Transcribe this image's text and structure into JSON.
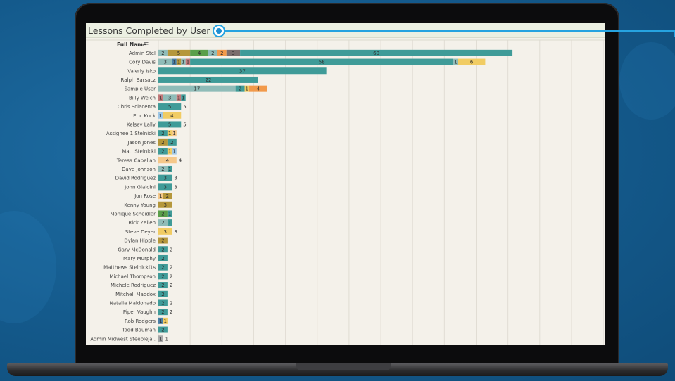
{
  "chart_data": {
    "type": "bar",
    "orientation": "horizontal",
    "stacked": true,
    "title": "Lessons Completed by User",
    "row_header": "Full Name",
    "grid": true,
    "colors": [
      "#8fbcb8",
      "#b5973b",
      "#5a9f4a",
      "#f29a4b",
      "#7b6d6d",
      "#3f9b98",
      "#f1cc63",
      "#9fc7e6",
      "#4a7fa6",
      "#c2797a",
      "#aaaaaa",
      "#f5c88a"
    ],
    "rows": [
      {
        "name": "Admin Stel",
        "segments": [
          {
            "v": 2,
            "c": 0
          },
          {
            "v": 5,
            "c": 1
          },
          {
            "v": 4,
            "c": 2
          },
          {
            "v": 2,
            "c": 0
          },
          {
            "v": 2,
            "c": 3
          },
          {
            "v": 3,
            "c": 4
          },
          {
            "v": 60,
            "c": 5
          }
        ],
        "total": ""
      },
      {
        "name": "Cory Davis",
        "segments": [
          {
            "v": 3,
            "c": 0
          },
          {
            "v": 1,
            "c": 8
          },
          {
            "v": 1,
            "c": 1
          },
          {
            "v": 1,
            "c": 0
          },
          {
            "v": 1,
            "c": 9
          },
          {
            "v": 58,
            "c": 5
          },
          {
            "v": 1,
            "c": 0
          },
          {
            "v": 6,
            "c": 6
          }
        ],
        "total": ""
      },
      {
        "name": "Valeriy Isko",
        "segments": [
          {
            "v": 37,
            "c": 5
          }
        ],
        "total": ""
      },
      {
        "name": "Ralph Barsacz",
        "segments": [
          {
            "v": 22,
            "c": 5
          }
        ],
        "total": ""
      },
      {
        "name": "Sample User",
        "segments": [
          {
            "v": 17,
            "c": 0
          },
          {
            "v": 2,
            "c": 5
          },
          {
            "v": 1,
            "c": 6
          },
          {
            "v": 4,
            "c": 3
          }
        ],
        "total": ""
      },
      {
        "name": "Billy Welch",
        "segments": [
          {
            "v": 1,
            "c": 9
          },
          {
            "v": 3,
            "c": 0
          },
          {
            "v": 1,
            "c": 9
          },
          {
            "v": 1,
            "c": 5
          }
        ],
        "total": ""
      },
      {
        "name": "Chris Sciacenta",
        "segments": [
          {
            "v": 5,
            "c": 5
          }
        ],
        "total": "5"
      },
      {
        "name": "Eric Kuck",
        "segments": [
          {
            "v": 1,
            "c": 7
          },
          {
            "v": 4,
            "c": 6
          }
        ],
        "total": ""
      },
      {
        "name": "Kelsey Lally",
        "segments": [
          {
            "v": 5,
            "c": 5
          }
        ],
        "total": "5"
      },
      {
        "name": "Assignee 1 Stelnicki",
        "segments": [
          {
            "v": 2,
            "c": 5
          },
          {
            "v": 1,
            "c": 6
          },
          {
            "v": 1,
            "c": 11
          }
        ],
        "total": ""
      },
      {
        "name": "Jason Jones",
        "segments": [
          {
            "v": 2,
            "c": 1
          },
          {
            "v": 2,
            "c": 5
          }
        ],
        "total": ""
      },
      {
        "name": "Matt Stelnicki",
        "segments": [
          {
            "v": 2,
            "c": 5
          },
          {
            "v": 1,
            "c": 6
          },
          {
            "v": 1,
            "c": 7
          }
        ],
        "total": ""
      },
      {
        "name": "Teresa Capellan",
        "segments": [
          {
            "v": 4,
            "c": 11
          }
        ],
        "total": "4"
      },
      {
        "name": "Dave Johnson",
        "segments": [
          {
            "v": 2,
            "c": 0
          },
          {
            "v": 1,
            "c": 5
          }
        ],
        "total": ""
      },
      {
        "name": "David Rodriguez",
        "segments": [
          {
            "v": 3,
            "c": 5
          }
        ],
        "total": "3"
      },
      {
        "name": "John Gialdini",
        "segments": [
          {
            "v": 3,
            "c": 5
          }
        ],
        "total": "3"
      },
      {
        "name": "Jon Rose",
        "segments": [
          {
            "v": 1,
            "c": 11
          },
          {
            "v": 2,
            "c": 1
          }
        ],
        "total": ""
      },
      {
        "name": "Kenny Young",
        "segments": [
          {
            "v": 3,
            "c": 1
          }
        ],
        "total": ""
      },
      {
        "name": "Monique Scheidler",
        "segments": [
          {
            "v": 2,
            "c": 2
          },
          {
            "v": 1,
            "c": 5
          }
        ],
        "total": ""
      },
      {
        "name": "Rick Zellen",
        "segments": [
          {
            "v": 2,
            "c": 0
          },
          {
            "v": 1,
            "c": 5
          }
        ],
        "total": ""
      },
      {
        "name": "Steve Deyer",
        "segments": [
          {
            "v": 3,
            "c": 6
          }
        ],
        "total": "3"
      },
      {
        "name": "Dylan Hipple",
        "segments": [
          {
            "v": 2,
            "c": 1
          }
        ],
        "total": ""
      },
      {
        "name": "Gary McDonald",
        "segments": [
          {
            "v": 2,
            "c": 5
          }
        ],
        "total": "2"
      },
      {
        "name": "Mary Murphy",
        "segments": [
          {
            "v": 2,
            "c": 5
          }
        ],
        "total": ""
      },
      {
        "name": "Matthews Stelnicki1s",
        "segments": [
          {
            "v": 2,
            "c": 5
          }
        ],
        "total": "2"
      },
      {
        "name": "Michael Thompson",
        "segments": [
          {
            "v": 2,
            "c": 5
          }
        ],
        "total": "2"
      },
      {
        "name": "Michele Rodriguez",
        "segments": [
          {
            "v": 2,
            "c": 5
          }
        ],
        "total": "2"
      },
      {
        "name": "Mitchell Maddox",
        "segments": [
          {
            "v": 2,
            "c": 5
          }
        ],
        "total": ""
      },
      {
        "name": "Natalia Maldonado",
        "segments": [
          {
            "v": 2,
            "c": 5
          }
        ],
        "total": "2"
      },
      {
        "name": "Piper Vaughn",
        "segments": [
          {
            "v": 2,
            "c": 5
          }
        ],
        "total": "2"
      },
      {
        "name": "Rob Rodgers",
        "segments": [
          {
            "v": 1,
            "c": 8
          },
          {
            "v": 1,
            "c": 6
          }
        ],
        "total": ""
      },
      {
        "name": "Todd Bauman",
        "segments": [
          {
            "v": 2,
            "c": 5
          }
        ],
        "total": ""
      },
      {
        "name": "Admin Midwest Steepleja..",
        "segments": [
          {
            "v": 1,
            "c": 10
          }
        ],
        "total": "1"
      }
    ]
  }
}
